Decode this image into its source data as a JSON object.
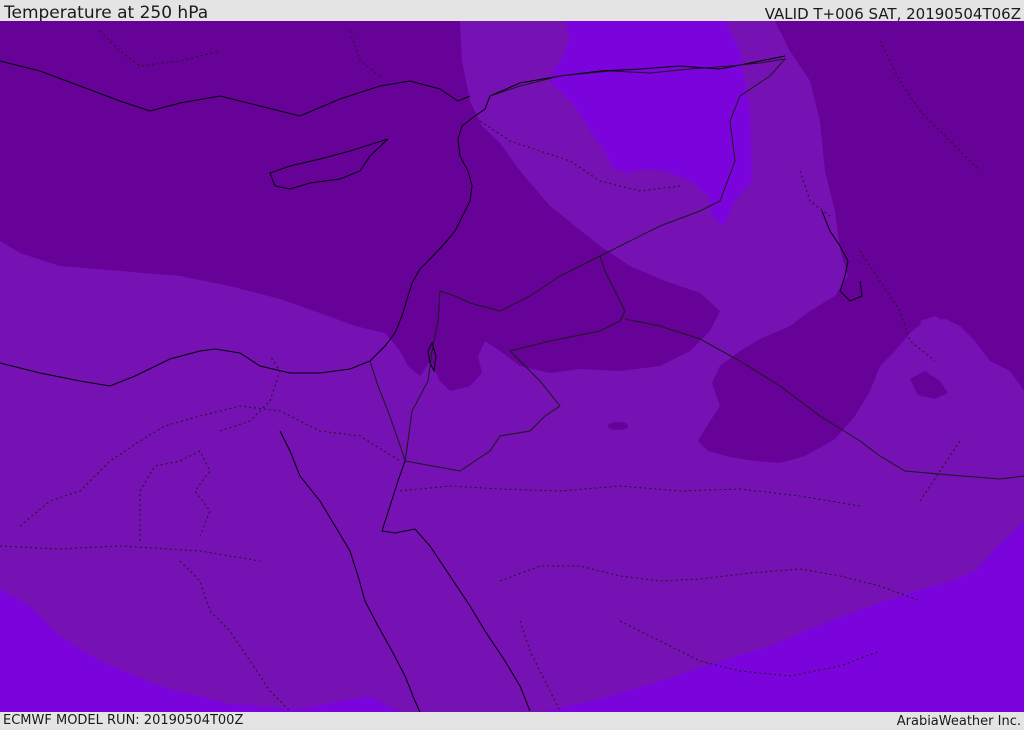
{
  "header": {
    "title": "Temperature at 250 hPa",
    "valid": "VALID T+006 SAT, 20190504T06Z"
  },
  "footer": {
    "model_run": "ECMWF MODEL RUN: 20190504T00Z",
    "credit": "ArabiaWeather Inc."
  },
  "colors": {
    "band_coldest": "#7b04dc",
    "band_mid": "#7611b4",
    "band_warm": "#660298",
    "coastline": "#000000",
    "border": "#1a1a1a"
  }
}
